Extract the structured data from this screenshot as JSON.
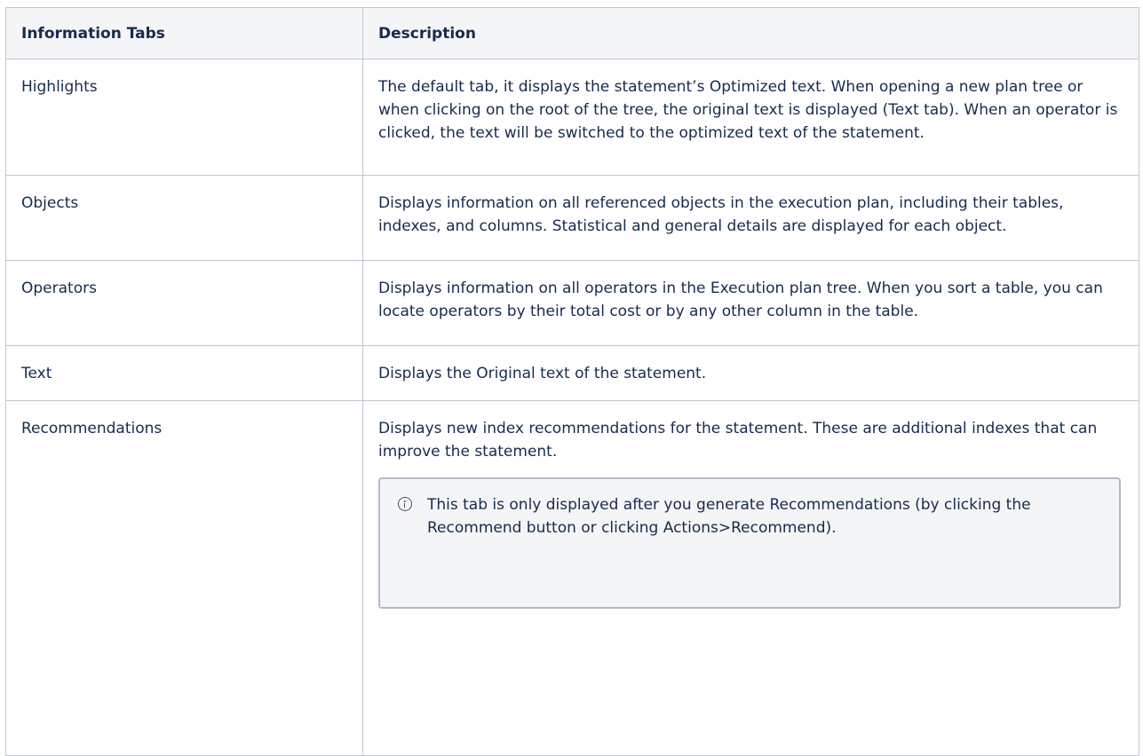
{
  "table": {
    "headers": {
      "tab": "Information Tabs",
      "description": "Description"
    },
    "rows": [
      {
        "tab": "Highlights",
        "description": "The default tab, it displays the statement’s Optimized text. When opening a new plan tree or when clicking on the root of the tree, the original text is displayed (Text tab). When an operator is clicked, the text will be switched to the optimized text of the statement."
      },
      {
        "tab": "Objects",
        "description": "Displays information on all referenced objects in the execution plan, including their tables, indexes, and columns. Statistical and general details are displayed for each object."
      },
      {
        "tab": "Operators",
        "description": "Displays information on all operators in the Execution plan tree. When you sort a table, you can locate operators by their total cost or by any other column in the table."
      },
      {
        "tab": "Text",
        "description": "Displays the Original text of the statement."
      },
      {
        "tab": "Recommendations",
        "description": "Displays new index recommendations for the statement. These are additional indexes that can improve the statement.",
        "info_note": "This tab is only displayed after you generate Recommendations (by clicking the Recommend button or clicking Actions>Recommend)."
      }
    ]
  },
  "icons": {
    "info": "info-icon"
  },
  "colors": {
    "header_background": "#f4f5f7",
    "border": "#c1c7d0",
    "text": "#172b4d",
    "info_panel_background": "#f4f5f7",
    "info_panel_border": "#b3bac5"
  }
}
